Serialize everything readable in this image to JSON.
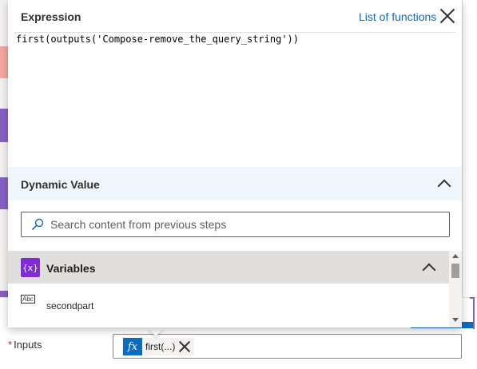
{
  "expression_panel": {
    "title": "Expression",
    "list_functions_label": "List of functions",
    "expression_text": "first(outputs('Compose-remove_the_query_string'))"
  },
  "dynamic_value": {
    "title": "Dynamic Value",
    "search_placeholder": "Search content from previous steps",
    "search_value": "",
    "icons": {
      "search": "search-icon",
      "collapse": "chevron-up-icon"
    }
  },
  "variables": {
    "title": "Variables",
    "icon_label": "{x}",
    "items": [
      {
        "type_label": "Abc",
        "name": "secondpart"
      }
    ]
  },
  "inputs_field": {
    "label": "Inputs",
    "required_marker": "*",
    "token_icon": "fx",
    "token_label": "first(...)"
  },
  "colors": {
    "accent": "#0f6cbd",
    "variables_icon": "#7e2dd6",
    "dynamic_header_bg": "#eff6fc",
    "required": "#a4262c"
  }
}
